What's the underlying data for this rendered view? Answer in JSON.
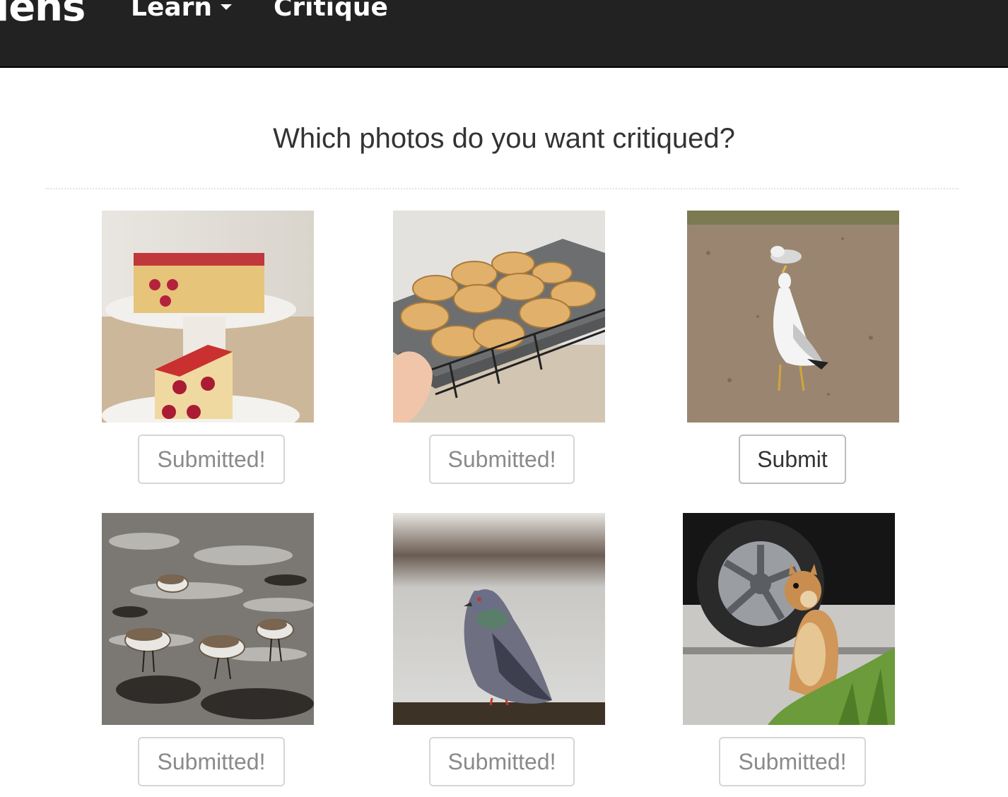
{
  "navbar": {
    "brand": "lens",
    "items": [
      {
        "label": "Learn",
        "has_dropdown": true
      },
      {
        "label": "Critique",
        "has_dropdown": false
      }
    ]
  },
  "page": {
    "title": "Which photos do you want critiqued?"
  },
  "photos": [
    {
      "subject": "cake",
      "button_label": "Submitted!",
      "submitted": true
    },
    {
      "subject": "muffins",
      "button_label": "Submitted!",
      "submitted": true
    },
    {
      "subject": "seagull",
      "button_label": "Submit",
      "submitted": false
    },
    {
      "subject": "sandpipers",
      "button_label": "Submitted!",
      "submitted": true
    },
    {
      "subject": "pigeon",
      "button_label": "Submitted!",
      "submitted": true
    },
    {
      "subject": "squirrel",
      "button_label": "Submitted!",
      "submitted": true
    }
  ],
  "colors": {
    "navbar_bg": "#222222",
    "nav_text": "#ffffff",
    "button_border": "#d6d6d6",
    "submitted_text": "#8a8a8a",
    "submit_text": "#333333"
  }
}
